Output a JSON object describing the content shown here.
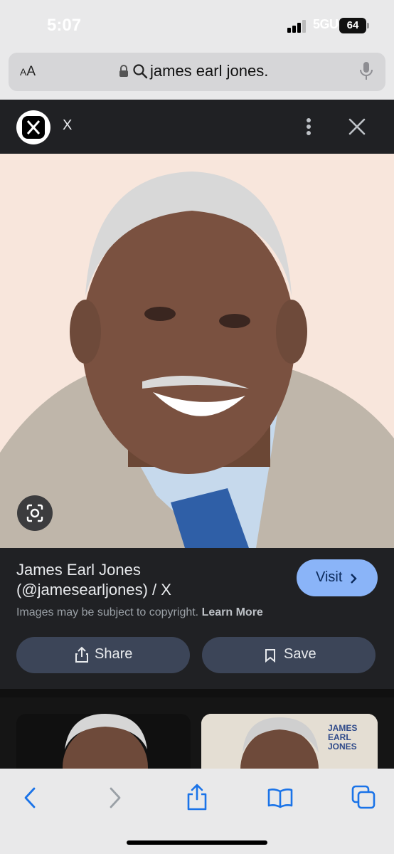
{
  "status_bar": {
    "time": "5:07",
    "network": "5GUC",
    "battery": "64"
  },
  "address_bar": {
    "text_size_label_small": "A",
    "text_size_label_large": "A",
    "query": "james earl jones."
  },
  "viewer_header": {
    "site_name": "X"
  },
  "result": {
    "title_line1": "James Earl Jones",
    "title_line2": "(@jamesearljones) / X",
    "visit_label": "Visit",
    "copyright_text": "Images may be subject to copyright.",
    "learn_more_label": "Learn More",
    "share_label": "Share",
    "save_label": "Save"
  },
  "related": {
    "thumb2_text": "JAMES EARL JONES"
  },
  "colors": {
    "accent": "#8ab4f8",
    "panel": "#202124",
    "button": "#3c4558",
    "ios_blue": "#1a73e8"
  },
  "icons": [
    "signal-icon",
    "lock-icon",
    "search-icon",
    "mic-icon",
    "x-logo",
    "more-vert-icon",
    "close-icon",
    "lens-icon",
    "chevron-right-icon",
    "share-icon",
    "bookmark-icon",
    "back-icon",
    "forward-icon",
    "ios-share-icon",
    "bookmarks-icon",
    "tabs-icon"
  ]
}
